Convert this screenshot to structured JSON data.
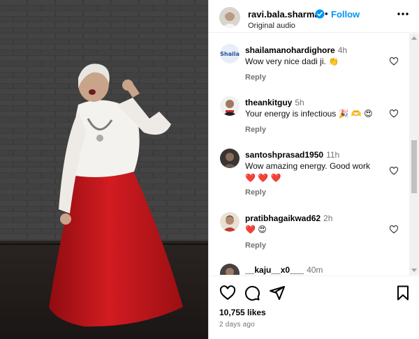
{
  "post": {
    "username": "ravi.bala.sharma",
    "dot": "•",
    "follow_label": "Follow",
    "audio_label": "Original audio",
    "verified": true
  },
  "comments": [
    {
      "username": "shailamanohardighore",
      "time": "4h",
      "text": "Wow very nice dadi ji. 👏",
      "reply_label": "Reply"
    },
    {
      "username": "theankitguy",
      "time": "5h",
      "text": "Your energy is infectious 🎉 🫶 😍",
      "reply_label": "Reply"
    },
    {
      "username": "santoshprasad1950",
      "time": "11h",
      "text": "Wow amazing energy. Good work",
      "text2": "❤️ ❤️ ❤️",
      "reply_label": "Reply"
    },
    {
      "username": "pratibhagaikwad62",
      "time": "2h",
      "text": "❤️ 😍",
      "reply_label": "Reply"
    },
    {
      "username": "__kaju__x0___",
      "time": "40m"
    }
  ],
  "footer": {
    "likes": "10,755 likes",
    "posted": "2 days ago"
  },
  "colors": {
    "accent": "#0095f6",
    "skirt": "#c0161a",
    "wall": "#3a3a3a"
  },
  "icons": [
    "verified-badge-icon",
    "more-options-icon",
    "heart-icon",
    "comment-icon",
    "share-icon",
    "bookmark-icon"
  ]
}
